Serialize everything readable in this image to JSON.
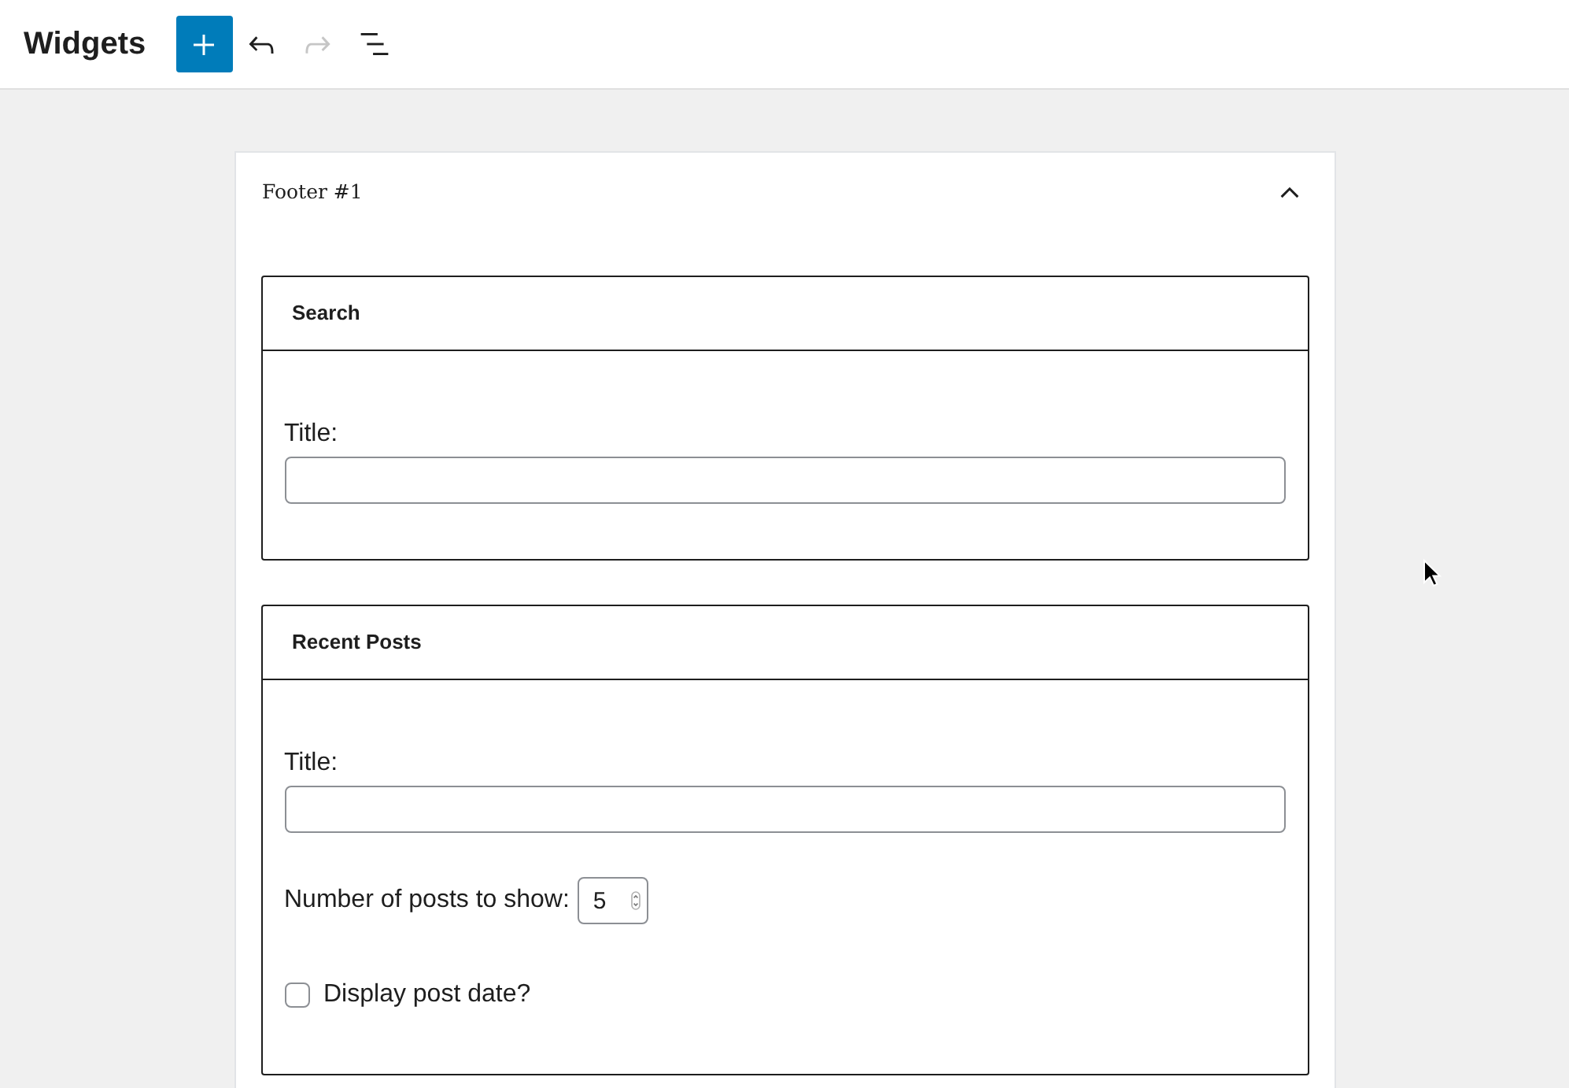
{
  "header": {
    "title": "Widgets",
    "toolbar": [
      {
        "kind": "add",
        "disabled": false
      },
      {
        "kind": "undo",
        "disabled": false
      },
      {
        "kind": "redo",
        "disabled": true
      },
      {
        "kind": "list",
        "disabled": false
      }
    ]
  },
  "area": {
    "title": "Footer #1",
    "expanded": true,
    "widgets": [
      {
        "title": "Search",
        "fields": [
          {
            "kind": "text",
            "label": "Title:"
          }
        ]
      },
      {
        "title": "Recent Posts",
        "fields": [
          {
            "kind": "text",
            "label": "Title:"
          },
          {
            "kind": "number",
            "label": "Number of posts to show:",
            "value": "5"
          },
          {
            "kind": "checkbox",
            "label": "Display post date?",
            "checked": false
          }
        ]
      }
    ]
  }
}
